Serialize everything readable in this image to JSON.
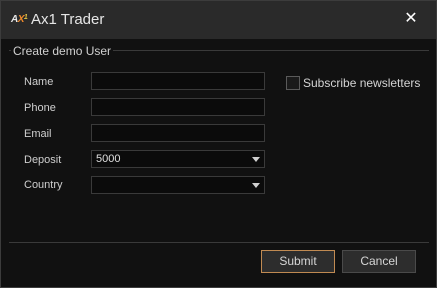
{
  "window": {
    "title": "Ax1 Trader",
    "logo": {
      "a": "A",
      "x": "X",
      "one": "1"
    },
    "close_label": "✕"
  },
  "form": {
    "group_title": "Create demo User",
    "fields": [
      {
        "label": "Name",
        "value": ""
      },
      {
        "label": "Phone",
        "value": ""
      },
      {
        "label": "Email",
        "value": ""
      },
      {
        "label": "Deposit",
        "value": "5000"
      },
      {
        "label": "Country",
        "value": ""
      }
    ],
    "subscribe_label": "Subscribe newsletters",
    "subscribe_checked": false
  },
  "buttons": {
    "submit": "Submit",
    "cancel": "Cancel"
  },
  "colors": {
    "background": "#111111",
    "titlebar": "#2a2a2a",
    "accent": "#c08a52"
  }
}
